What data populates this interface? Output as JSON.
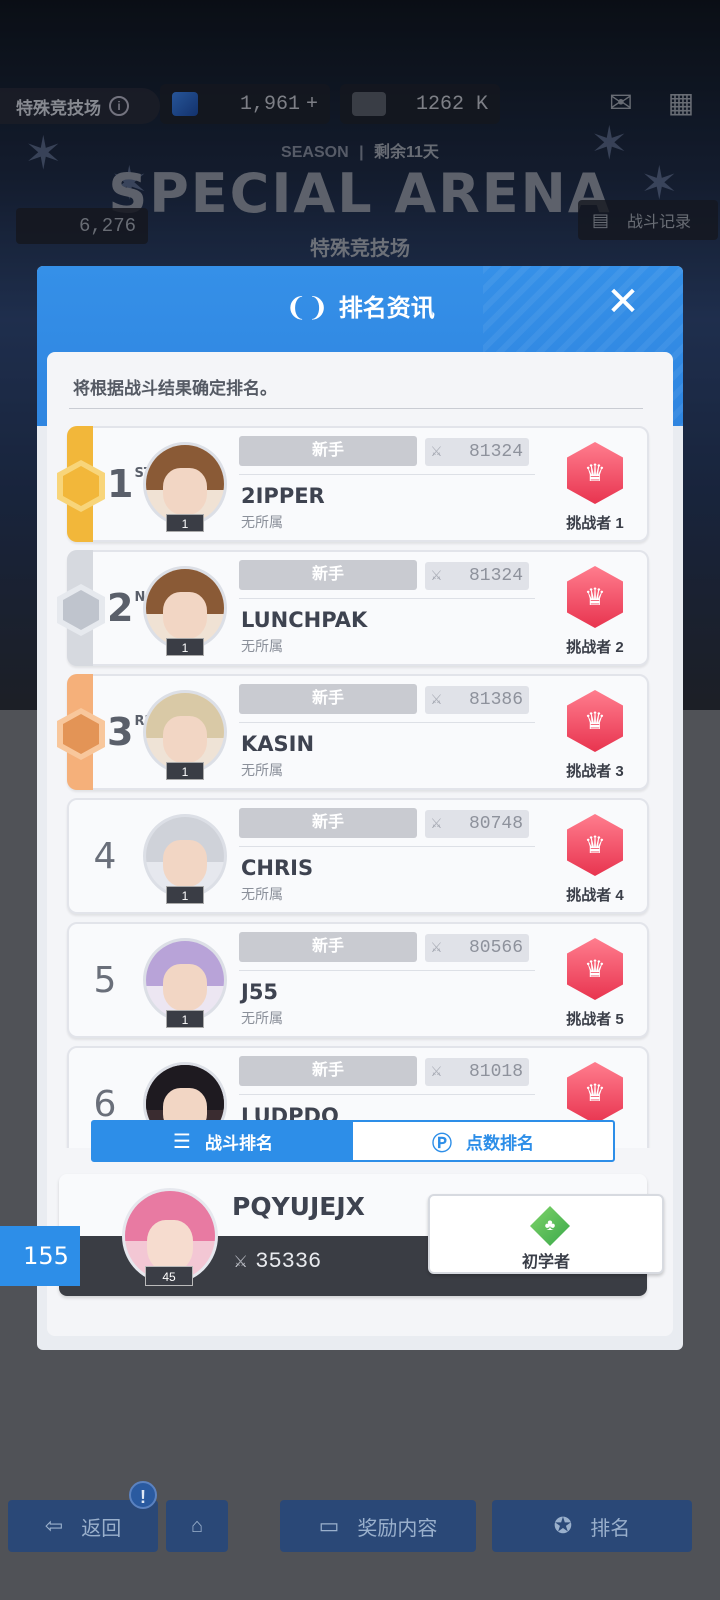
{
  "top": {
    "title": "特殊竞技场",
    "gems": "1,961",
    "gems_add": "+",
    "credits": "1262 K",
    "season_label": "SEASON",
    "season_left": "剩余11天",
    "arena_title": "SPECIAL ARENA",
    "arena_sub": "特殊竞技场",
    "points": "6,276",
    "battle_log": "战斗记录",
    "shop": "店"
  },
  "panel": {
    "title": "排名资讯",
    "notice": "将根据战斗结果确定排名。"
  },
  "rows": [
    {
      "rank": "1",
      "suffix": "ST",
      "badge": "新手",
      "power": "81324",
      "name": "2IPPER",
      "group": "无所属",
      "level": "1",
      "challenge": "挑战者 1"
    },
    {
      "rank": "2",
      "suffix": "ND",
      "badge": "新手",
      "power": "81324",
      "name": "LUNCHPAK",
      "group": "无所属",
      "level": "1",
      "challenge": "挑战者 2"
    },
    {
      "rank": "3",
      "suffix": "RD",
      "badge": "新手",
      "power": "81386",
      "name": "KASIN",
      "group": "无所属",
      "level": "1",
      "challenge": "挑战者 3"
    },
    {
      "rank": "4",
      "suffix": "",
      "badge": "新手",
      "power": "80748",
      "name": "CHRIS",
      "group": "无所属",
      "level": "1",
      "challenge": "挑战者 4"
    },
    {
      "rank": "5",
      "suffix": "",
      "badge": "新手",
      "power": "80566",
      "name": "J55",
      "group": "无所属",
      "level": "1",
      "challenge": "挑战者 5"
    },
    {
      "rank": "6",
      "suffix": "",
      "badge": "新手",
      "power": "81018",
      "name": "LUDPDQ",
      "group": "",
      "level": "",
      "challenge": ""
    }
  ],
  "tabs": {
    "battle": "战斗排名",
    "points": "点数排名"
  },
  "me": {
    "rank": "155",
    "name": "PQYUJEJX",
    "level": "45",
    "power": "35336",
    "tier": "初学者"
  },
  "bottom": {
    "back": "返回",
    "alert": "!",
    "rewards": "奖励内容",
    "ranking": "排名"
  },
  "colors": {
    "accent": "#2d8ee8",
    "gold": "#f2b73a",
    "silver": "#c8ccd4",
    "bronze": "#f0a868",
    "challenge": "#e8344f"
  }
}
